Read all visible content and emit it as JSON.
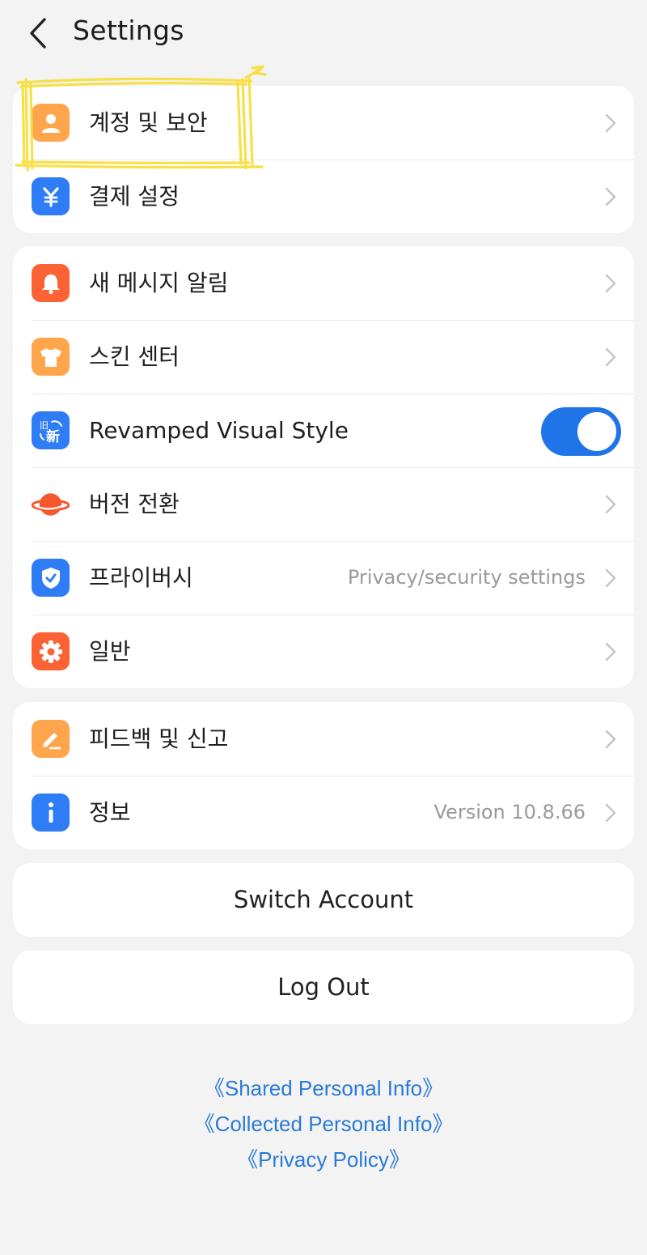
{
  "header": {
    "title": "Settings",
    "back_icon": "chevron-left-icon"
  },
  "groups": [
    {
      "items": [
        {
          "label": "계정 및 보안",
          "icon": "person-icon",
          "color": "#ffa64d",
          "control": "chevron",
          "value": ""
        },
        {
          "label": "결제 설정",
          "icon": "yen-icon",
          "color": "#2e7cf6",
          "control": "chevron",
          "value": ""
        }
      ]
    },
    {
      "items": [
        {
          "label": "새 메시지 알림",
          "icon": "bell-icon",
          "color": "#fb6234",
          "control": "chevron",
          "value": ""
        },
        {
          "label": "스킨 센터",
          "icon": "shirt-icon",
          "color": "#ffa64d",
          "control": "chevron",
          "value": ""
        },
        {
          "label": "Revamped Visual Style",
          "icon": "old-new-icon",
          "color": "#2e7cf6",
          "control": "toggle",
          "toggle_on": true,
          "value": ""
        },
        {
          "label": "버전 전환",
          "icon": "planet-icon",
          "color": "#f4582c",
          "control": "chevron",
          "value": ""
        },
        {
          "label": "프라이버시",
          "icon": "shield-check-icon",
          "color": "#2e7cf6",
          "control": "chevron",
          "value": "Privacy/security settings"
        },
        {
          "label": "일반",
          "icon": "gear-icon",
          "color": "#fb6234",
          "control": "chevron",
          "value": ""
        }
      ]
    },
    {
      "items": [
        {
          "label": "피드백 및 신고",
          "icon": "pencil-icon",
          "color": "#ffa64d",
          "control": "chevron",
          "value": ""
        },
        {
          "label": "정보",
          "icon": "info-icon",
          "color": "#2e7cf6",
          "control": "chevron",
          "value": "Version 10.8.66"
        }
      ]
    }
  ],
  "buttons": {
    "switch_account": "Switch Account",
    "log_out": "Log Out"
  },
  "links": [
    "《Shared Personal Info》",
    "《Collected Personal Info》",
    "《Privacy Policy》"
  ],
  "highlight_color": "#f7de3a"
}
